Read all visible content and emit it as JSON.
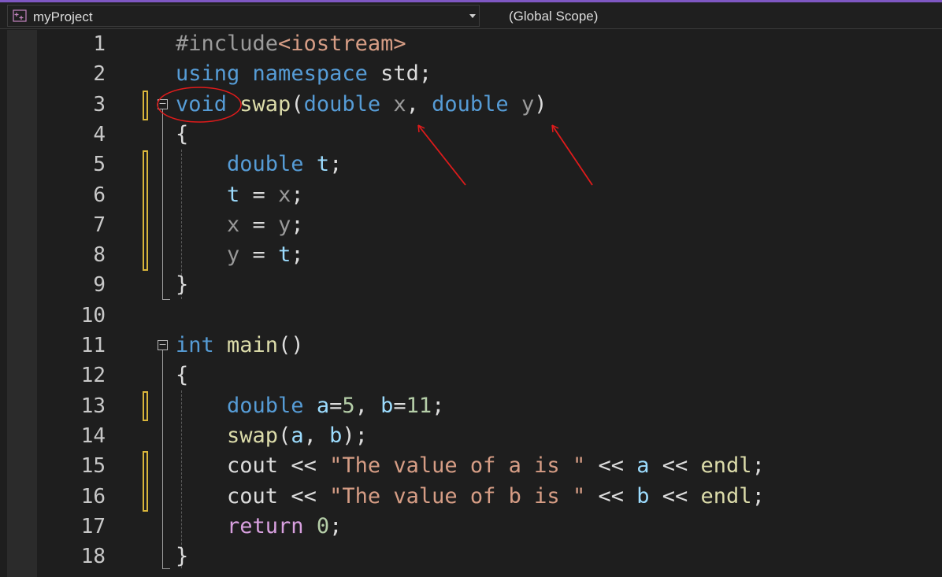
{
  "navbar": {
    "project": "myProject",
    "scope": "(Global Scope)"
  },
  "code_lines": [
    {
      "n": "1",
      "tokens": [
        [
          "#include",
          "preproc"
        ],
        [
          "<iostream>",
          "str"
        ]
      ]
    },
    {
      "n": "2",
      "tokens": [
        [
          "using ",
          "kw"
        ],
        [
          "namespace ",
          "kw"
        ],
        [
          "std",
          "var"
        ],
        [
          ";",
          "punc"
        ]
      ]
    },
    {
      "n": "3",
      "tokens": [
        [
          "void ",
          "kw"
        ],
        [
          "swap",
          "fn"
        ],
        [
          "(",
          "punc"
        ],
        [
          "double ",
          "kw"
        ],
        [
          "x",
          "param"
        ],
        [
          ", ",
          "punc"
        ],
        [
          "double ",
          "kw"
        ],
        [
          "y",
          "param"
        ],
        [
          ")",
          "punc"
        ]
      ]
    },
    {
      "n": "4",
      "tokens": [
        [
          "{",
          "punc"
        ]
      ]
    },
    {
      "n": "5",
      "tokens": [
        [
          "    double ",
          "kw"
        ],
        [
          "t",
          "local"
        ],
        [
          ";",
          "punc"
        ]
      ]
    },
    {
      "n": "6",
      "tokens": [
        [
          "    ",
          "punc"
        ],
        [
          "t",
          "local"
        ],
        [
          " = ",
          "punc"
        ],
        [
          "x",
          "param"
        ],
        [
          ";",
          "punc"
        ]
      ]
    },
    {
      "n": "7",
      "tokens": [
        [
          "    ",
          "punc"
        ],
        [
          "x",
          "param"
        ],
        [
          " = ",
          "punc"
        ],
        [
          "y",
          "param"
        ],
        [
          ";",
          "punc"
        ]
      ]
    },
    {
      "n": "8",
      "tokens": [
        [
          "    ",
          "punc"
        ],
        [
          "y",
          "param"
        ],
        [
          " = ",
          "punc"
        ],
        [
          "t",
          "local"
        ],
        [
          ";",
          "punc"
        ]
      ]
    },
    {
      "n": "9",
      "tokens": [
        [
          "}",
          "punc"
        ]
      ]
    },
    {
      "n": "10",
      "tokens": []
    },
    {
      "n": "11",
      "tokens": [
        [
          "int ",
          "kw"
        ],
        [
          "main",
          "fn"
        ],
        [
          "()",
          "punc"
        ]
      ]
    },
    {
      "n": "12",
      "tokens": [
        [
          "{",
          "punc"
        ]
      ]
    },
    {
      "n": "13",
      "tokens": [
        [
          "    double ",
          "kw"
        ],
        [
          "a",
          "local"
        ],
        [
          "=",
          "punc"
        ],
        [
          "5",
          "num"
        ],
        [
          ", ",
          "punc"
        ],
        [
          "b",
          "local"
        ],
        [
          "=",
          "punc"
        ],
        [
          "11",
          "num"
        ],
        [
          ";",
          "punc"
        ]
      ]
    },
    {
      "n": "14",
      "tokens": [
        [
          "    ",
          "punc"
        ],
        [
          "swap",
          "fn"
        ],
        [
          "(",
          "punc"
        ],
        [
          "a",
          "local"
        ],
        [
          ", ",
          "punc"
        ],
        [
          "b",
          "local"
        ],
        [
          ");",
          "punc"
        ]
      ]
    },
    {
      "n": "15",
      "tokens": [
        [
          "    cout ",
          "var"
        ],
        [
          "<< ",
          "punc"
        ],
        [
          "\"The value of a is \"",
          "str"
        ],
        [
          " << ",
          "punc"
        ],
        [
          "a",
          "local"
        ],
        [
          " << ",
          "punc"
        ],
        [
          "endl",
          "fn"
        ],
        [
          ";",
          "punc"
        ]
      ]
    },
    {
      "n": "16",
      "tokens": [
        [
          "    cout ",
          "var"
        ],
        [
          "<< ",
          "punc"
        ],
        [
          "\"The value of b is \"",
          "str"
        ],
        [
          " << ",
          "punc"
        ],
        [
          "b",
          "local"
        ],
        [
          " << ",
          "punc"
        ],
        [
          "endl",
          "fn"
        ],
        [
          ";",
          "punc"
        ]
      ]
    },
    {
      "n": "17",
      "tokens": [
        [
          "    return ",
          "ctrl"
        ],
        [
          "0",
          "num"
        ],
        [
          ";",
          "punc"
        ]
      ]
    },
    {
      "n": "18",
      "tokens": [
        [
          "}",
          "punc"
        ]
      ]
    }
  ],
  "colors": {
    "background": "#1e1e1e",
    "keyword": "#569cd6",
    "function": "#dcdcaa",
    "string": "#d69d85",
    "annotation": "#e01b1b",
    "change_marker": "#d8b53b"
  }
}
